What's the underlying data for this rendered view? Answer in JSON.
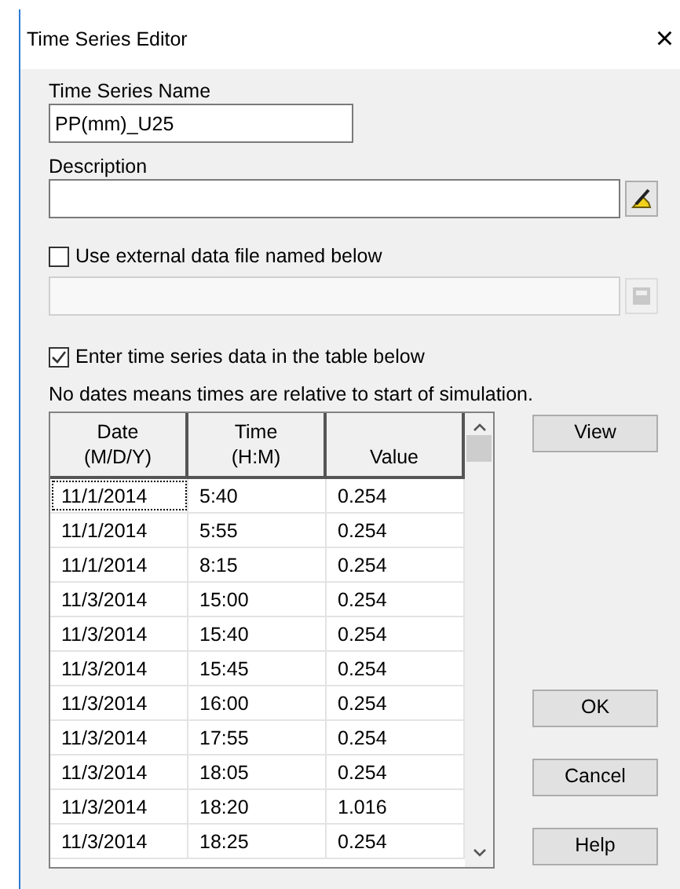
{
  "window": {
    "title": "Time Series Editor",
    "close": "×"
  },
  "name_field": {
    "label": "Time Series Name",
    "value": "PP(mm)_U25"
  },
  "description_field": {
    "label": "Description"
  },
  "external_file": {
    "label": "Use external data file named below",
    "checked": false,
    "disabled": true
  },
  "table_entry": {
    "label": "Enter time series data in the table below",
    "checked": true
  },
  "note": "No dates means times are relative to start of simulation.",
  "table": {
    "columns": [
      {
        "line1": "Date",
        "line2": "(M/D/Y)"
      },
      {
        "line1": "Time",
        "line2": "(H:M)"
      },
      {
        "line2": "Value"
      }
    ],
    "rows": [
      {
        "date": "11/1/2014",
        "time": "5:40",
        "value": "0.254",
        "focused": true
      },
      {
        "date": "11/1/2014",
        "time": "5:55",
        "value": "0.254",
        "focused": false
      },
      {
        "date": "11/1/2014",
        "time": "8:15",
        "value": "0.254",
        "focused": false
      },
      {
        "date": "11/3/2014",
        "time": "15:00",
        "value": "0.254",
        "focused": false
      },
      {
        "date": "11/3/2014",
        "time": "15:40",
        "value": "0.254",
        "focused": false
      },
      {
        "date": "11/3/2014",
        "time": "15:45",
        "value": "0.254",
        "focused": false
      },
      {
        "date": "11/3/2014",
        "time": "16:00",
        "value": "0.254",
        "focused": false
      },
      {
        "date": "11/3/2014",
        "time": "17:55",
        "value": "0.254",
        "focused": false
      },
      {
        "date": "11/3/2014",
        "time": "18:05",
        "value": "0.254",
        "focused": false
      },
      {
        "date": "11/3/2014",
        "time": "18:20",
        "value": "1.016",
        "focused": false
      },
      {
        "date": "11/3/2014",
        "time": "18:25",
        "value": "0.254",
        "focused": false
      }
    ]
  },
  "buttons": {
    "view": "View",
    "ok": "OK",
    "cancel": "Cancel",
    "help": "Help"
  }
}
